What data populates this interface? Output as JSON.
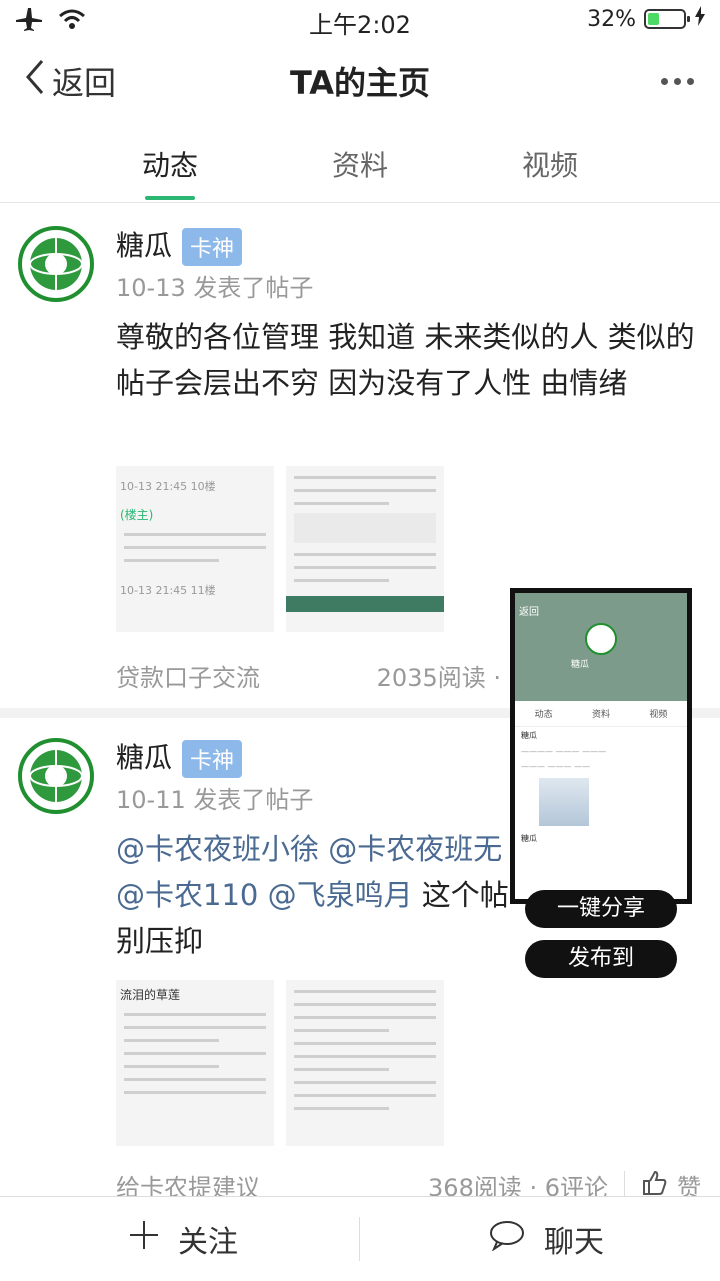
{
  "status_bar": {
    "time": "上午2:02",
    "battery": "32%",
    "battery_level": 0.32
  },
  "nav": {
    "back": "返回",
    "title": "TA的主页"
  },
  "tabs": [
    {
      "label": "动态"
    },
    {
      "label": "资料"
    },
    {
      "label": "视频"
    }
  ],
  "posts": [
    {
      "user": "糖瓜",
      "badge": "卡神",
      "meta": "10-13 发表了帖子",
      "text": "尊敬的各位管理 我知道 未来类似的人 类似的帖子会层出不穷 因为没有了人性 由情绪",
      "category": "贷款口子交流",
      "stats": "2035阅读 ·"
    },
    {
      "user": "糖瓜",
      "badge": "卡神",
      "meta": "10-11 发表了帖子",
      "mentions": "@卡农夜班小徐 @卡农夜班无",
      "mentions2": "@卡农110 @飞泉鸣月",
      "text_tail": " 这个帖",
      "text_line3": "别压抑",
      "category": "给卡农提建议",
      "stats": "368阅读 · 6评论",
      "like": "赞"
    }
  ],
  "thumb1": {
    "time": "10-13 21:45  10楼",
    "name": "(楼主)",
    "time2": "10-13 21:45  11楼"
  },
  "thumb3": {
    "title": "流泪的草莲"
  },
  "share_card": {
    "back": "返回",
    "tabs": [
      "动态",
      "资料",
      "视频"
    ],
    "name": "糖瓜"
  },
  "share_buttons": {
    "share": "一键分享",
    "publish": "发布到"
  },
  "bottom": {
    "follow": "关注",
    "chat": "聊天"
  }
}
